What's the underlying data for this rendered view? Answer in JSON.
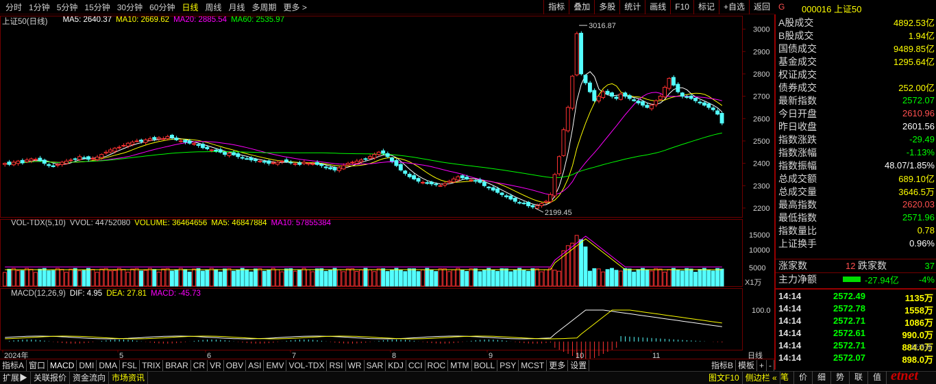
{
  "topbar": {
    "periods": [
      "分时",
      "1分钟",
      "5分钟",
      "15分钟",
      "30分钟",
      "60分钟",
      "日线",
      "周线",
      "月线",
      "多周期",
      "更多 >"
    ],
    "active_period": "日线",
    "tools": [
      "指标",
      "叠加",
      "多股",
      "统计",
      "画线",
      "F10",
      "标记",
      "+自选",
      "返回"
    ]
  },
  "quote_header": {
    "g_label": "G",
    "code": "000016",
    "name": "上证50"
  },
  "main_legend": {
    "title": "上证50(日线)",
    "ma5": "MA5: 2640.37",
    "ma10": "MA10: 2669.62",
    "ma20": "MA20: 2885.54",
    "ma60": "MA60: 2535.97"
  },
  "vol_legend": {
    "title": "VOL-TDX(5,10)",
    "vvol": "VVOL: 44752080",
    "volume": "VOLUME: 36464656",
    "ma5": "MA5: 46847884",
    "ma10": "MA10: 57855384",
    "unit": "X1万"
  },
  "macd_legend": {
    "title": "MACD(12,26,9)",
    "dif": "DIF: 4.95",
    "dea": "DEA: 27.81",
    "macd": "MACD: -45.73"
  },
  "annotations": {
    "high": "3016.87",
    "low": "2199.45"
  },
  "price_axis": [
    "3000",
    "2900",
    "2800",
    "2700",
    "2600",
    "2500",
    "2400",
    "2300",
    "2200"
  ],
  "vol_axis": [
    "15000",
    "10000",
    "5000"
  ],
  "macd_axis": [
    "100.0"
  ],
  "date_axis": [
    "2024年",
    "5",
    "6",
    "7",
    "8",
    "9",
    "10",
    "11"
  ],
  "date_axis_label": "日线",
  "colors": {
    "up": "#ff3232",
    "down": "#54ffff",
    "ma5": "#ffffff",
    "ma10": "#ffff00",
    "ma20": "#ff00ff",
    "ma60": "#00ff00",
    "bg": "#000000",
    "grid": "#700000"
  },
  "quote_panel": [
    {
      "k": "A股成交",
      "v": "4892.53亿",
      "c": "#ffff00"
    },
    {
      "k": "B股成交",
      "v": "1.94亿",
      "c": "#ffff00"
    },
    {
      "k": "国债成交",
      "v": "9489.85亿",
      "c": "#ffff00"
    },
    {
      "k": "基金成交",
      "v": "1295.64亿",
      "c": "#ffff00"
    },
    {
      "k": "权证成交",
      "v": "",
      "c": "#ffff00"
    },
    {
      "k": "债券成交",
      "v": "252.00亿",
      "c": "#ffff00"
    },
    {
      "k": "最新指数",
      "v": "2572.07",
      "c": "#00ff00"
    },
    {
      "k": "今日开盘",
      "v": "2610.96",
      "c": "#ff5050"
    },
    {
      "k": "昨日收盘",
      "v": "2601.56",
      "c": "#ffffff"
    },
    {
      "k": "指数涨跌",
      "v": "-29.49",
      "c": "#00ff00"
    },
    {
      "k": "指数涨幅",
      "v": "-1.13%",
      "c": "#00ff00"
    },
    {
      "k": "指数振幅",
      "v": "48.07/1.85%",
      "c": "#ffffff"
    },
    {
      "k": "总成交额",
      "v": "689.10亿",
      "c": "#ffff00"
    },
    {
      "k": "总成交量",
      "v": "3646.5万",
      "c": "#ffff00"
    },
    {
      "k": "最高指数",
      "v": "2620.03",
      "c": "#ff5050"
    },
    {
      "k": "最低指数",
      "v": "2571.96",
      "c": "#00ff00"
    },
    {
      "k": "指数量比",
      "v": "0.78",
      "c": "#ffff00"
    },
    {
      "k": "上证换手",
      "v": "0.96%",
      "c": "#ffffff"
    }
  ],
  "rise_fall": {
    "rise_label": "涨家数",
    "rise": "12",
    "fall_label": "跌家数",
    "fall": "37"
  },
  "net_flow": {
    "label": "主力净额",
    "value": "-27.94亿",
    "pct": "-4%"
  },
  "ticks": [
    {
      "t": "14:14",
      "p": "2572.49",
      "v": "1135万"
    },
    {
      "t": "14:14",
      "p": "2572.78",
      "v": "1558万"
    },
    {
      "t": "14:14",
      "p": "2572.71",
      "v": "1086万"
    },
    {
      "t": "14:14",
      "p": "2572.61",
      "v": "990.0万"
    },
    {
      "t": "14:14",
      "p": "2572.71",
      "v": "884.0万"
    },
    {
      "t": "14:14",
      "p": "2572.07",
      "v": "898.0万"
    }
  ],
  "indicator_tabs": [
    "指标A",
    "窗口",
    "MACD",
    "DMI",
    "DMA",
    "FSL",
    "TRIX",
    "BRAR",
    "CR",
    "VR",
    "OBV",
    "ASI",
    "EMV",
    "VOL-TDX",
    "RSI",
    "WR",
    "SAR",
    "KDJ",
    "CCI",
    "ROC",
    "MTM",
    "BOLL",
    "PSY",
    "MCST",
    "更多",
    "设置"
  ],
  "indicator_right": [
    "指标B",
    "模板",
    "+",
    "-"
  ],
  "statusbar": [
    "扩展▶",
    "关联报价",
    "资金流向",
    "市场资讯"
  ],
  "statusbar_active": "市场资讯",
  "statusbar_right": [
    "图文F10",
    "侧边栏 «"
  ],
  "rb_tabs": [
    "笔",
    "价",
    "细",
    "势",
    "联",
    "值"
  ],
  "watermark": "etnet",
  "watermark_sub": "经济通",
  "chart_data": {
    "type": "candlestick",
    "y_range": [
      2160,
      3060
    ],
    "ohlc_note": "approx daily candles",
    "closes": [
      2400,
      2395,
      2405,
      2410,
      2402,
      2415,
      2420,
      2418,
      2412,
      2400,
      2390,
      2385,
      2395,
      2405,
      2410,
      2415,
      2420,
      2430,
      2425,
      2418,
      2422,
      2428,
      2440,
      2450,
      2460,
      2468,
      2472,
      2480,
      2490,
      2495,
      2500,
      2498,
      2505,
      2510,
      2508,
      2515,
      2510,
      2520,
      2515,
      2505,
      2500,
      2495,
      2490,
      2488,
      2480,
      2470,
      2465,
      2460,
      2455,
      2450,
      2440,
      2445,
      2438,
      2430,
      2425,
      2420,
      2415,
      2412,
      2410,
      2405,
      2400,
      2402,
      2405,
      2410,
      2408,
      2402,
      2398,
      2395,
      2405,
      2400,
      2398,
      2395,
      2390,
      2380,
      2375,
      2370,
      2380,
      2390,
      2400,
      2405,
      2410,
      2415,
      2420,
      2430,
      2440,
      2450,
      2445,
      2430,
      2410,
      2390,
      2370,
      2355,
      2340,
      2330,
      2320,
      2315,
      2310,
      2308,
      2305,
      2300,
      2310,
      2320,
      2330,
      2340,
      2335,
      2330,
      2325,
      2320,
      2315,
      2300,
      2290,
      2280,
      2270,
      2260,
      2250,
      2240,
      2230,
      2225,
      2220,
      2210,
      2205,
      2210,
      2220,
      2230,
      2260,
      2350,
      2430,
      2550,
      2650,
      2790,
      2980,
      2800,
      2760,
      2720,
      2680,
      2700,
      2720,
      2710,
      2700,
      2690,
      2710,
      2700,
      2690,
      2680,
      2670,
      2660,
      2650,
      2660,
      2680,
      2700,
      2740,
      2780,
      2750,
      2720,
      2700,
      2695,
      2690,
      2680,
      2670,
      2660,
      2650,
      2640,
      2620,
      2580
    ],
    "ma60_end": 2535.97,
    "high_point": 3016.87,
    "low_point": 2199.45
  }
}
